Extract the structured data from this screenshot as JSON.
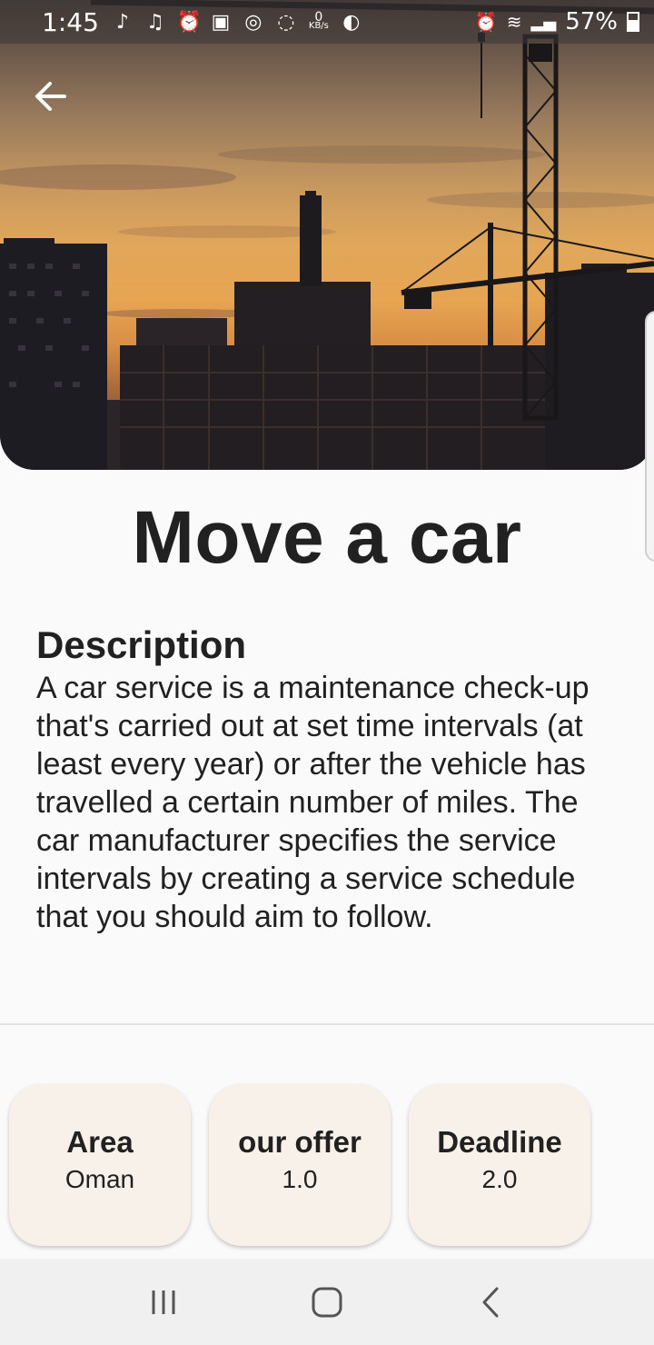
{
  "status_bar": {
    "time": "1:45",
    "battery": "57%",
    "data_rate_value": "0",
    "data_rate_unit": "KB/s",
    "icons": [
      "music-note-icon",
      "tiktok-icon",
      "alarm-icon",
      "image-icon",
      "sync-icon",
      "messenger-icon",
      "data-rate-icon",
      "app-icon",
      "alarm-icon",
      "wifi-icon",
      "signal-icon",
      "battery-icon"
    ]
  },
  "hero": {
    "image_description_icon": "construction-site-sunset-image",
    "back_icon": "arrow-left-icon"
  },
  "page": {
    "title": "Move a car",
    "description_heading": "Description",
    "description_body": "A car service is a maintenance check-up that's carried out at set time intervals (at least every year) or after the vehicle has travelled a certain number of miles. The car manufacturer specifies the service intervals by creating a service schedule that you should aim to follow."
  },
  "cards": [
    {
      "label": "Area",
      "value": "Oman"
    },
    {
      "label": "our offer",
      "value": "1.0"
    },
    {
      "label": "Deadline",
      "value": "2.0"
    }
  ],
  "nav_bar": {
    "icons": [
      "recent-apps-icon",
      "home-icon",
      "back-icon"
    ]
  },
  "colors": {
    "background": "#fafafa",
    "card_background": "#f8f1ea",
    "text": "#212121",
    "nav_background": "#f0f0f0"
  }
}
